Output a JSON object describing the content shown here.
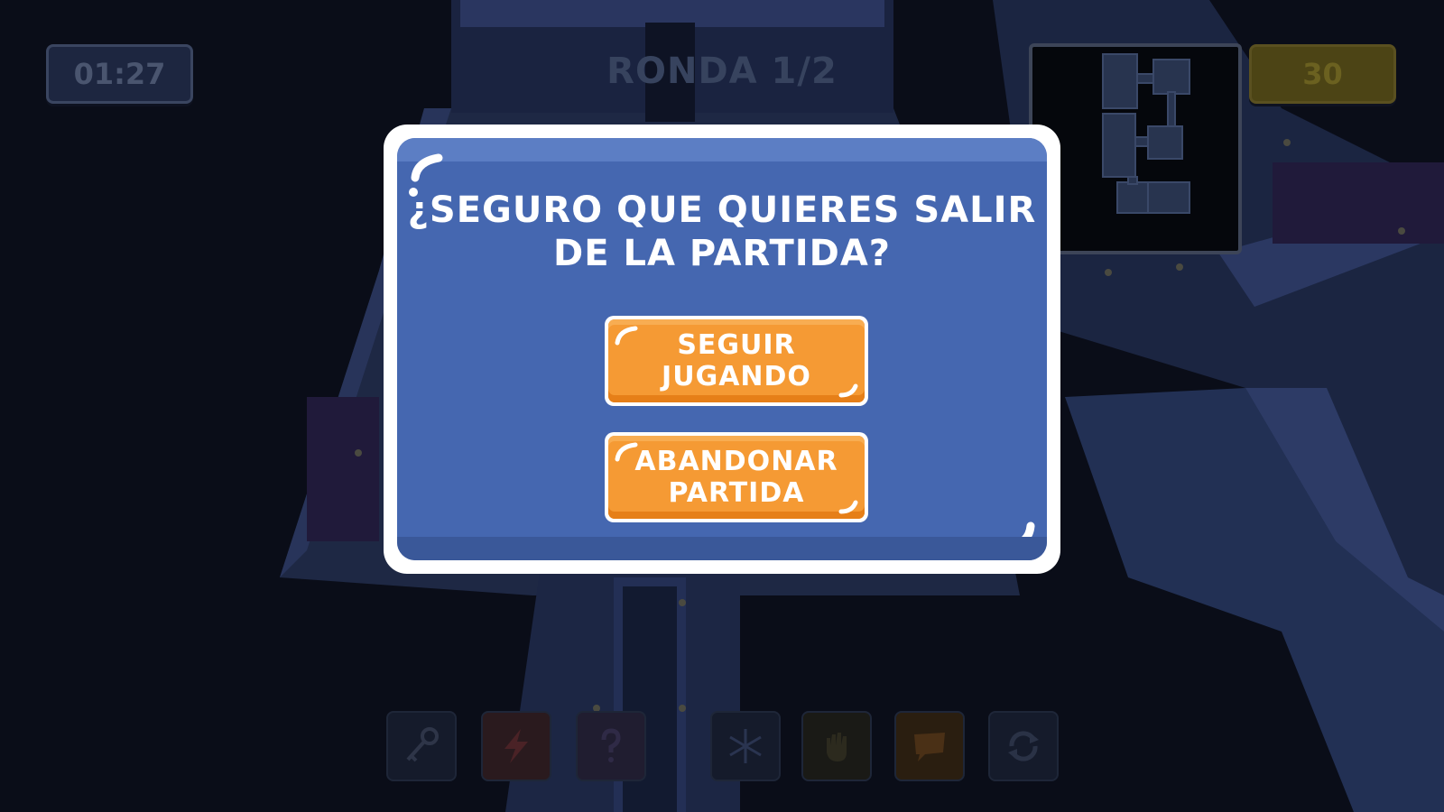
{
  "hud": {
    "timer": "01:27",
    "round": "RONDA 1/2",
    "score": "30"
  },
  "dialog": {
    "title": "¿SEGURO QUE QUIERES SALIR\nDE LA PARTIDA?",
    "continue_label": "SEGUIR\nJUGANDO",
    "leave_label": "ABANDONAR\nPARTIDA"
  },
  "toolbar": {
    "items": [
      {
        "icon": "key-icon"
      },
      {
        "icon": "lightning-icon"
      },
      {
        "icon": "question-icon"
      },
      {
        "icon": "snowflake-icon"
      },
      {
        "icon": "hand-icon"
      },
      {
        "icon": "chat-icon"
      },
      {
        "icon": "refresh-icon"
      }
    ]
  },
  "colors": {
    "dialog_bg": "#4567b0",
    "button_orange": "#f59a34",
    "score_bg": "#4c4415"
  }
}
